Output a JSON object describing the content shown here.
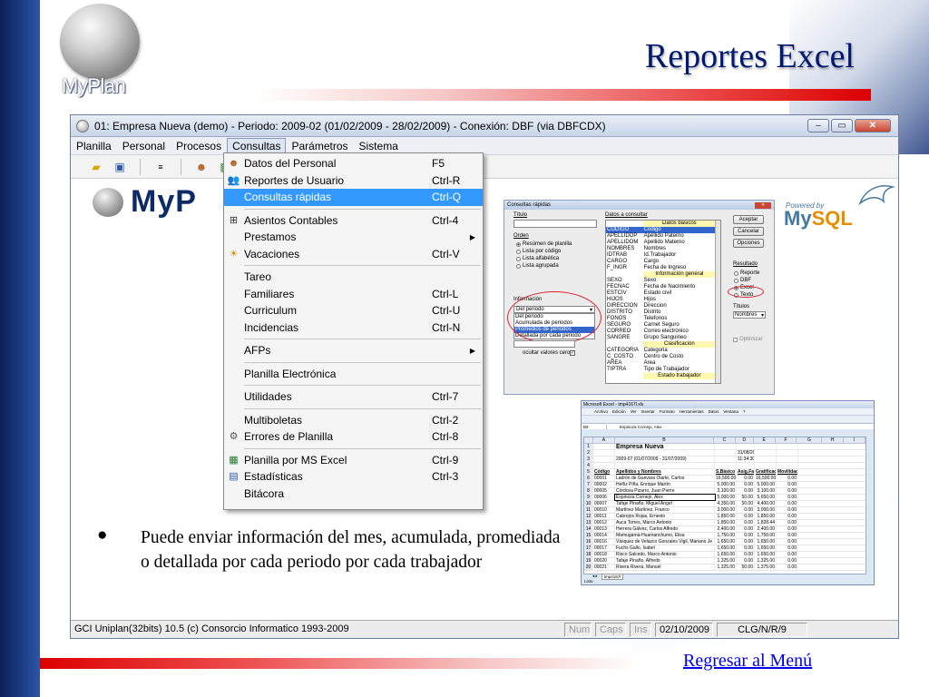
{
  "slide": {
    "title": "Reportes Excel",
    "logo_text": "MyPlan",
    "bullet_symbol": "●",
    "bullet_text": "Puede enviar información del mes, acumulada, promediada o detallada por cada periodo por cada trabajador",
    "back_link": "Regresar al Menú"
  },
  "app": {
    "title": "01: Empresa Nueva  (demo)  - Periodo: 2009-02 (01/02/2009 - 28/02/2009) - Conexión: DBF (via DBFCDX)",
    "menu": [
      "Planilla",
      "Personal",
      "Procesos",
      "Consultas",
      "Parámetros",
      "Sistema"
    ],
    "active_menu": "Consultas",
    "logo_text": "MyP",
    "status": [
      "GCI Uniplan(32bits) 10.5  (c) Consorcio Informatico 1993-2009",
      "Num",
      "Caps",
      "Ins",
      "02/10/2009",
      "CLG/N/R/9"
    ]
  },
  "dropdown": [
    {
      "label": "Datos del Personal",
      "shortcut": "F5",
      "icon": "person-icon"
    },
    {
      "label": "Reportes de Usuario",
      "shortcut": "Ctrl-R",
      "icon": "users-report-icon"
    },
    {
      "label": "Consultas rápidas",
      "shortcut": "Ctrl-Q",
      "highlight": true
    },
    {
      "sep": true
    },
    {
      "label": "Asientos Contables",
      "shortcut": "Ctrl-4",
      "icon": "accounting-icon"
    },
    {
      "label": "Prestamos",
      "shortcut": "",
      "submenu": true
    },
    {
      "label": "Vacaciones",
      "shortcut": "Ctrl-V",
      "icon": "vacation-icon"
    },
    {
      "sep": true
    },
    {
      "label": "Tareo",
      "shortcut": ""
    },
    {
      "label": "Familiares",
      "shortcut": "Ctrl-L"
    },
    {
      "label": "Curriculum",
      "shortcut": "Ctrl-U"
    },
    {
      "label": "Incidencias",
      "shortcut": "Ctrl-N"
    },
    {
      "sep": true
    },
    {
      "label": "AFPs",
      "shortcut": "",
      "submenu": true
    },
    {
      "sep": true
    },
    {
      "label": "Planilla Electrónica",
      "shortcut": ""
    },
    {
      "sep": true
    },
    {
      "label": "Utilidades",
      "shortcut": "Ctrl-7"
    },
    {
      "sep": true
    },
    {
      "label": "Multiboletas",
      "shortcut": "Ctrl-2"
    },
    {
      "label": "Errores de Planilla",
      "shortcut": "Ctrl-8",
      "icon": "gear-icon"
    },
    {
      "sep": true
    },
    {
      "label": "Planilla por MS Excel",
      "shortcut": "Ctrl-9",
      "icon": "excel-icon"
    },
    {
      "label": "Estadísticas",
      "shortcut": "Ctrl-3",
      "icon": "chart-icon"
    },
    {
      "label": "Bitácora",
      "shortcut": ""
    }
  ],
  "dialog": {
    "title": "Consultas rápidas",
    "titulo_label": "Título",
    "orden_label": "Orden",
    "orden_options": [
      "Resúmen de planilla",
      "Lista por código",
      "Lista alfabética",
      "Lista agrupada"
    ],
    "informacion_label": "Información",
    "informacion_value": "Del periodo",
    "informacion_options": [
      "Del periodo",
      "Acumulada de periodos",
      "Promedios de periodos",
      "Detallada por cada periodo"
    ],
    "ocultar_label": "ocultar valores cero",
    "datos_label": "Datos a consultar",
    "codes": [
      "CODIGO",
      "APELLIDOP",
      "APELLIDOM",
      "NOMBRES",
      "IDTRAB",
      "CARGO",
      "F_INGR",
      "",
      "SEXO",
      "FECNAC",
      "ESTCIV",
      "HIJOS",
      "DIRECCION",
      "DISTRITO",
      "FONOS",
      "SEGURO",
      "CORREO",
      "SANGRE",
      "",
      "CATEGORIA",
      "C_COSTO",
      "AREA",
      "TIPTRA"
    ],
    "descs": [
      "Datos básicos",
      "Código",
      "Apellido Paterno",
      "Apellido Materno",
      "Nombres",
      "Id.Trabajador",
      "Cargo",
      "Fecha de Ingreso",
      "Información general",
      "Sexo",
      "Fecha de Nacimiento",
      "Estado civil",
      "Hijos",
      "Direccion",
      "Distrito",
      "Telefonos",
      "Carnet Seguro",
      "Correo electrónico",
      "Grupo Sanguineo",
      "Clasificación",
      "Categoria",
      "Centro de Costo",
      "Area",
      "Tipo de Trabajador",
      "Estado trabajador"
    ],
    "buttons": [
      "Aceptar",
      "Cancelar",
      "Opciones"
    ],
    "resultado_label": "Resultado",
    "resultado_options": [
      "Reporte",
      "DBF",
      "Excel",
      "Texto"
    ],
    "titulos_label": "Títulos",
    "titulos_value": "Nombres",
    "optimizar_label": "Optimizar"
  },
  "mysql": {
    "powered": "Powered by",
    "my": "My",
    "sql": "SQL"
  },
  "excel": {
    "title": "Microsoft Excel - tmp4167l.xls",
    "menu": [
      "Archivo",
      "Edición",
      "Ver",
      "Insertar",
      "Formato",
      "Herramientas",
      "Datos",
      "Ventana",
      "?"
    ],
    "cell_ref": "B9",
    "formula": "Espinoza Cornejo, Alex",
    "columns": [
      "A",
      "B",
      "C",
      "D",
      "E",
      "F",
      "G",
      "H",
      "I"
    ],
    "rows": [
      [
        "1",
        "",
        "Empresa Nueva",
        "",
        "",
        "",
        ""
      ],
      [
        "2",
        "",
        "",
        "",
        "31/08/2009",
        "",
        ""
      ],
      [
        "3",
        "",
        "2009-07 (01/07/2009 - 31/07/2009)",
        "",
        "11:34:30",
        "",
        ""
      ],
      [
        "4",
        "",
        "",
        "",
        "",
        "",
        ""
      ],
      [
        "5",
        "Código",
        "Apellidos y Nombres",
        "S.Básico",
        "Asig.Fam",
        "Gratificac",
        "Movilidad"
      ],
      [
        "6",
        "00001",
        "Ladrón de Guevara Olarte, Carlos",
        "16,500.00",
        "0.00",
        "16,500.00",
        "0.00"
      ],
      [
        "7",
        "00002",
        "Heñiz Piña, Enrique Martín",
        "5,000.00",
        "0.00",
        "5,000.00",
        "0.00"
      ],
      [
        "8",
        "00005",
        "Córdova Pizarro, Juan Pierre",
        "3,100.00",
        "0.00",
        "3,100.00",
        "0.00"
      ],
      [
        "9",
        "00006",
        "Espinoza Cornejo, Alex",
        "5,000.00",
        "50.00",
        "5,650.00",
        "0.00"
      ],
      [
        "10",
        "00007",
        "Tafaje Pinaño, Miguel Angel",
        "4,350.00",
        "50.00",
        "4,400.00",
        "0.00"
      ],
      [
        "11",
        "00010",
        "Martínez Martínez, Franco",
        "3,000.00",
        "0.00",
        "3,000.00",
        "0.00"
      ],
      [
        "12",
        "00011",
        "Cabrejos Rojas, Ernesto",
        "1,850.00",
        "0.00",
        "1,850.00",
        "0.00"
      ],
      [
        "13",
        "00012",
        "Auca Torres, Marco Antonio",
        "1,850.00",
        "0.00",
        "1,828.44",
        "0.00"
      ],
      [
        "14",
        "00013",
        "Herrera Gálvez, Carlos Alfredo",
        "2,400.00",
        "0.00",
        "2,400.00",
        "0.00"
      ],
      [
        "15",
        "00014",
        "Mamugama-Huamanchumo, Elisa",
        "1,750.00",
        "0.00",
        "1,750.00",
        "0.00"
      ],
      [
        "16",
        "00016",
        "Vásquez de Velazco Gonzales Vigil, Mariano Je",
        "1,650.00",
        "0.00",
        "1,650.00",
        "0.00"
      ],
      [
        "17",
        "00017",
        "Fuchs Gallo, Isabel",
        "1,650.00",
        "0.00",
        "1,650.00",
        "0.00"
      ],
      [
        "18",
        "00018",
        "Risco Salcedo, Marco Antonio",
        "1,650.00",
        "0.00",
        "1,650.00",
        "0.00"
      ],
      [
        "19",
        "00020",
        "Tafaje Pinaño, Alfredo",
        "1,325.00",
        "0.00",
        "1,325.00",
        "0.00"
      ],
      [
        "20",
        "00021",
        "Rivera Rivera, Manuel",
        "1,325.00",
        "50.00",
        "1,375.00",
        "0.00"
      ]
    ],
    "sheet_tab": "tmp4167l",
    "status": "Listo"
  }
}
